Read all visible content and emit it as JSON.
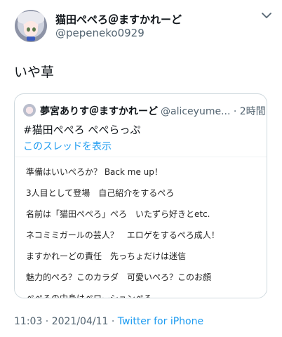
{
  "author": {
    "display_name": "猫田ぺぺろ＠ますかれーど",
    "handle": "@pepeneko0929"
  },
  "tweet": {
    "text": "いや草"
  },
  "quoted": {
    "display_name": "夢宮ありす＠ますかれーど",
    "handle_time": "@aliceyume... · 2時間",
    "text": "#猫田ぺぺろ ぺぺらっぷ",
    "thread_link": "このスレッドを表示",
    "image_lines": [
      "準備はいいぺろか？ Back me up！",
      "3人目として登場　自己紹介をするぺろ",
      "名前は「猫田ぺぺろ」ぺろ　いたずら好きとetc.",
      "ネコミミガールの芸人？　エロゲをするぺろ成人！",
      "ますかれーどの責任　先っちょだけは迷信",
      "魅力的ぺろ？このカラダ　可愛いぺろ？このお顔",
      "ぺぺろの中身はぺローションぺろ"
    ]
  },
  "meta": {
    "timestamp": "11:03 · 2021/04/11 · ",
    "client": "Twitter for iPhone"
  },
  "icons": {
    "more": "chevron-down-icon"
  }
}
